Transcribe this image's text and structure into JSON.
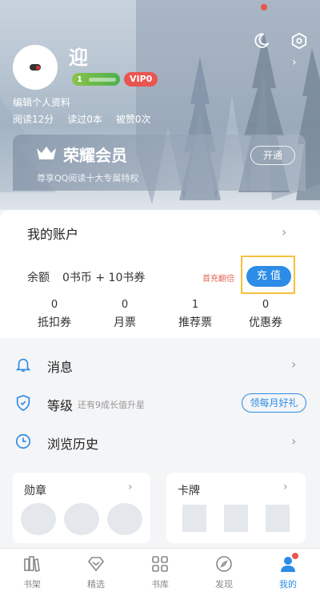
{
  "header": {
    "username": "迎",
    "level": "1",
    "vip": "VIP0",
    "edit_profile": "编辑个人资料",
    "stats": {
      "read_time": "阅读12分",
      "read_books": "读过0本",
      "praised": "被赞0次"
    }
  },
  "vip_card": {
    "title": "荣耀会员",
    "subtitle": "尊享QQ阅读十大专属特权",
    "button": "开通"
  },
  "account": {
    "title": "我的账户",
    "balance_label": "余额",
    "balance_value": "0书币 + 10书券",
    "double_tip": "首充翻倍",
    "recharge": "充 值",
    "vouchers": [
      {
        "num": "0",
        "label": "抵扣券"
      },
      {
        "num": "0",
        "label": "月票"
      },
      {
        "num": "1",
        "label": "推荐票"
      },
      {
        "num": "0",
        "label": "优惠券"
      }
    ]
  },
  "menu": {
    "messages": "消息",
    "level": "等级",
    "level_note": "还有9成长值升星",
    "month_gift": "领每月好礼",
    "history": "浏览历史"
  },
  "cards": {
    "medals": "勋章",
    "cards": "卡牌"
  },
  "tabs": [
    {
      "label": "书架",
      "icon": "bookshelf-icon"
    },
    {
      "label": "精选",
      "icon": "diamond-icon"
    },
    {
      "label": "书库",
      "icon": "grid-icon"
    },
    {
      "label": "发现",
      "icon": "compass-icon"
    },
    {
      "label": "我的",
      "icon": "profile-icon"
    }
  ],
  "colors": {
    "accent": "#2c8ce6",
    "vip_red": "#e9564f",
    "highlight": "#f4c23a"
  }
}
